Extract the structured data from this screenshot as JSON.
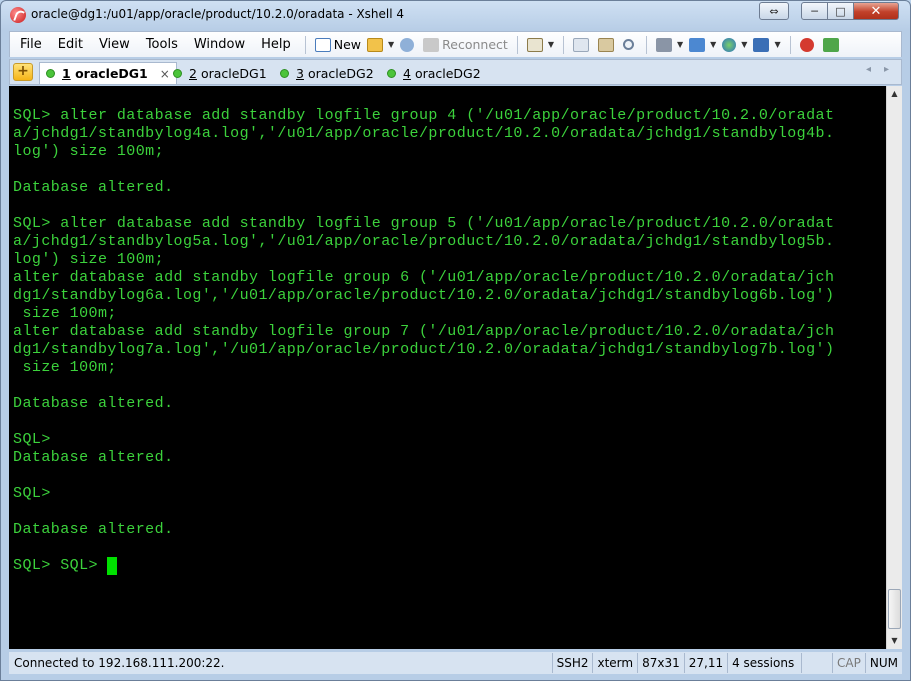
{
  "window": {
    "title": "oracle@dg1:/u01/app/oracle/product/10.2.0/oradata - Xshell 4",
    "close_glyph": "✕",
    "min_glyph": "─",
    "max_glyph": "□",
    "restore_glyph": "⇔"
  },
  "menu": [
    "File",
    "Edit",
    "View",
    "Tools",
    "Window",
    "Help"
  ],
  "toolbar": {
    "new_label": "New",
    "reconnect_label": "Reconnect"
  },
  "tabs": [
    {
      "num": "1",
      "label": "oracleDG1",
      "active": true
    },
    {
      "num": "2",
      "label": "oracleDG1",
      "active": false
    },
    {
      "num": "3",
      "label": "oracleDG2",
      "active": false
    },
    {
      "num": "4",
      "label": "oracleDG2",
      "active": false
    }
  ],
  "tab_close_glyph": "×",
  "add_tab_glyph": "+",
  "tab_nav": {
    "prev": "◂",
    "next": "▸"
  },
  "terminal": {
    "lines": [
      "SQL> alter database add standby logfile group 4 ('/u01/app/oracle/product/10.2.0/oradat",
      "a/jchdg1/standbylog4a.log','/u01/app/oracle/product/10.2.0/oradata/jchdg1/standbylog4b.",
      "log') size 100m;",
      "",
      "Database altered.",
      "",
      "SQL> alter database add standby logfile group 5 ('/u01/app/oracle/product/10.2.0/oradat",
      "a/jchdg1/standbylog5a.log','/u01/app/oracle/product/10.2.0/oradata/jchdg1/standbylog5b.",
      "log') size 100m;",
      "alter database add standby logfile group 6 ('/u01/app/oracle/product/10.2.0/oradata/jch",
      "dg1/standbylog6a.log','/u01/app/oracle/product/10.2.0/oradata/jchdg1/standbylog6b.log')",
      " size 100m;",
      "alter database add standby logfile group 7 ('/u01/app/oracle/product/10.2.0/oradata/jch",
      "dg1/standbylog7a.log','/u01/app/oracle/product/10.2.0/oradata/jchdg1/standbylog7b.log')",
      " size 100m;",
      "",
      "Database altered.",
      "",
      "SQL>",
      "Database altered.",
      "",
      "SQL>",
      "",
      "Database altered.",
      ""
    ],
    "prompt_line": "SQL> SQL> "
  },
  "scrollbar": {
    "up": "▲",
    "down": "▼"
  },
  "status": {
    "connection": "Connected to 192.168.111.200:22.",
    "protocol": "SSH2",
    "term": "xterm",
    "size": "87x31",
    "cursor": "27,11",
    "sessions": "4 sessions",
    "caps": "CAP",
    "num": "NUM"
  },
  "colors": {
    "terminal_bg": "#000000",
    "terminal_fg": "#3cd23c",
    "cursor": "#00e000"
  }
}
